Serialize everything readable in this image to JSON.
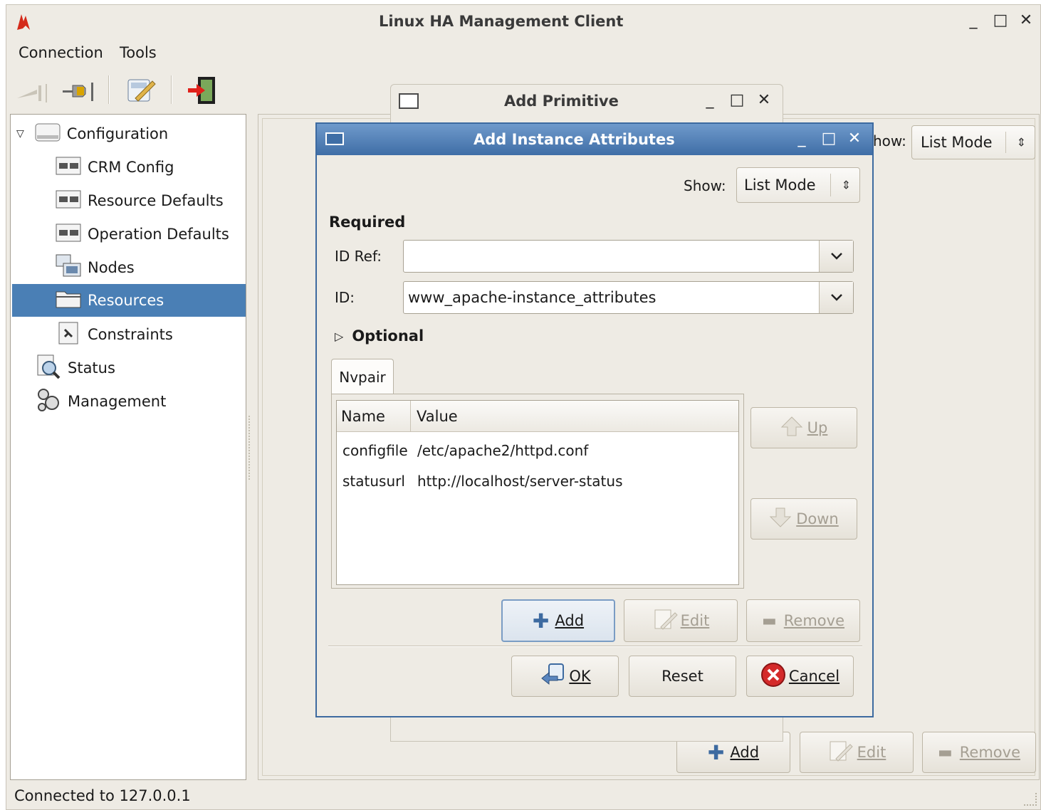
{
  "window": {
    "title": "Linux HA Management Client",
    "controls": [
      "_",
      "□",
      "✕"
    ]
  },
  "menubar": {
    "items": [
      "Connection",
      "Tools"
    ]
  },
  "toolbar": {
    "icons": [
      "disconnect-icon",
      "connect-icon",
      "wizard-icon",
      "exit-icon"
    ]
  },
  "sidebar": {
    "items": [
      {
        "label": "Configuration",
        "icon": "drive-icon"
      },
      {
        "label": "CRM Config",
        "icon": "config-icon"
      },
      {
        "label": "Resource Defaults",
        "icon": "config-icon"
      },
      {
        "label": "Operation Defaults",
        "icon": "config-icon"
      },
      {
        "label": "Nodes",
        "icon": "nodes-icon"
      },
      {
        "label": "Resources",
        "icon": "folder-icon"
      },
      {
        "label": "Constraints",
        "icon": "constraints-icon"
      },
      {
        "label": "Status",
        "icon": "magnifier-icon"
      },
      {
        "label": "Management",
        "icon": "gears-icon"
      }
    ],
    "selected": "Resources"
  },
  "background_panel": {
    "show_label": "how:",
    "show_value": "List Mode",
    "add_label": "Add",
    "edit_label": "Edit",
    "remove_label": "Remove"
  },
  "primitive_dialog": {
    "title": "Add Primitive",
    "controls": [
      "_",
      "□",
      "✕"
    ]
  },
  "dialog": {
    "title": "Add Instance Attributes",
    "controls": [
      "_",
      "□",
      "✕"
    ],
    "show_label": "Show:",
    "show_value": "List Mode",
    "required_heading": "Required",
    "id_ref_label": "ID Ref:",
    "id_ref_value": "",
    "id_label": "ID:",
    "id_value": "www_apache-instance_attributes",
    "optional_heading": "Optional",
    "tab_label": "Nvpair",
    "table": {
      "columns": [
        "Name",
        "Value"
      ],
      "rows": [
        {
          "name": "configfile",
          "value": "/etc/apache2/httpd.conf"
        },
        {
          "name": "statusurl",
          "value": "http://localhost/server-status"
        }
      ]
    },
    "up_label": "Up",
    "down_label": "Down",
    "add_label": "Add",
    "edit_label": "Edit",
    "remove_label": "Remove",
    "ok_label": "OK",
    "reset_label": "Reset",
    "cancel_label": "Cancel"
  },
  "statusbar": {
    "text": "Connected to 127.0.0.1"
  }
}
